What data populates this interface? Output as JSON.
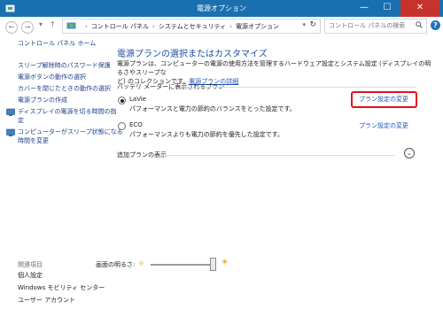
{
  "window": {
    "title": "電源オプション",
    "minimize": "—",
    "maximize": "☐",
    "close": "✕"
  },
  "address": {
    "crumbs": [
      "コントロール パネル",
      "システムとセキュリティ",
      "電源オプション"
    ],
    "search_placeholder": "コントロール パネルの検索"
  },
  "sidebar": {
    "home": "コントロール パネル ホーム",
    "links": [
      "スリープ解除時のパスワード保護",
      "電源ボタンの動作の選択",
      "カバーを閉じたときの動作の選択",
      "電源プランの作成"
    ],
    "icon_links": [
      {
        "line1": "ディスプレイの電源を切る時間の指",
        "line2": "定"
      },
      {
        "line1": "コンピューターがスリープ状態になる",
        "line2": "時間を変更"
      }
    ],
    "see_also": "関連項目",
    "bottom_links": [
      "個人設定",
      "Windows モビリティ センター",
      "ユーザー アカウント"
    ]
  },
  "main": {
    "heading": "電源プランの選択またはカスタマイズ",
    "desc_line1": "電源プランは、コンピューターの電源の使用方法を管理するハードウェア設定とシステム設定 (ディスプレイの明るさやスリープな",
    "desc_line2": "ど) のコレクションです。",
    "desc_link": "電源プランの詳細",
    "group_label": "バッテリ メーターに表示されるプラン",
    "plans": [
      {
        "name": "LaVie",
        "desc": "パフォーマンスと電力の節約のバランスをとった設定です。",
        "link": "プラン設定の変更",
        "selected": true
      },
      {
        "name": "ECO",
        "desc": "パフォーマンスよりも電力の節約を優先した設定です。",
        "link": "プラン設定の変更",
        "selected": false
      }
    ],
    "extra_plans": "追加プランの表示"
  },
  "brightness": {
    "label": "画面の明るさ:",
    "level_percent": 100
  }
}
